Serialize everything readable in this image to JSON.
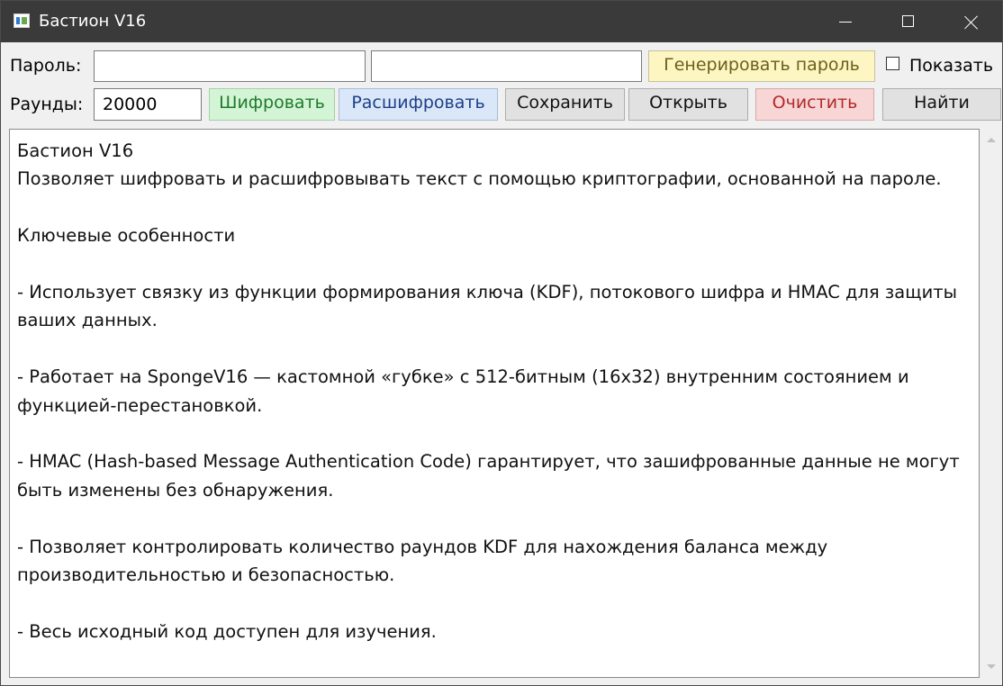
{
  "window": {
    "title": "Бастион V16"
  },
  "password_row": {
    "label": "Пароль:",
    "password_value": "",
    "confirm_value": "",
    "generate_button": "Генерировать пароль",
    "show_label": "Показать",
    "show_checked": false
  },
  "rounds_row": {
    "label": "Раунды:",
    "rounds_value": "20000",
    "buttons": {
      "encrypt": "Шифровать",
      "decrypt": "Расшифровать",
      "save": "Сохранить",
      "open": "Открыть",
      "clear": "Очистить",
      "find": "Найти"
    }
  },
  "editor": {
    "content": "Бастион V16\nПозволяет шифровать и расшифровывать текст с помощью криптографии, основанной на пароле.\n\nКлючевые особенности\n\n- Использует связку из функции формирования ключа (KDF), потокового шифра и HMAC для защиты ваших данных.\n\n- Работает на SpongeV16 — кастомной «губке» с 512-битным (16x32) внутренним состоянием и функцией-перестановкой.\n\n- HMAC (Hash-based Message Authentication Code) гарантирует, что зашифрованные данные не могут быть изменены без обнаружения.\n\n- Позволяет контролировать количество раундов KDF для нахождения баланса между производительностью и безопасностью.\n\n- Весь исходный код доступен для изучения."
  },
  "colors": {
    "titlebar": "#3a3a3a",
    "generate_bg": "#fdf6c3",
    "encrypt_bg": "#d4f4d6",
    "decrypt_bg": "#d9e7f8",
    "clear_bg": "#f8d6d6"
  }
}
